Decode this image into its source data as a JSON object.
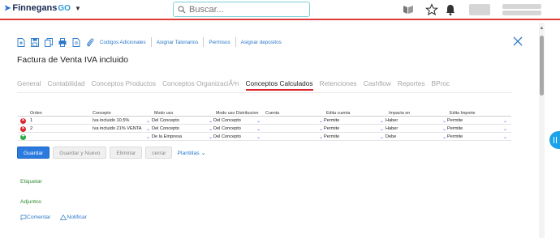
{
  "header": {
    "brand_name": "Finnegans",
    "brand_suffix": "GO",
    "search_placeholder": "Buscar..."
  },
  "toolbar": {
    "links": [
      "Codigos Adicionales",
      "Asignar Talonarios",
      "Permisos",
      "Asignar depositos"
    ]
  },
  "page": {
    "title": "Factura de Venta IVA incluido"
  },
  "tabs": [
    {
      "label": "General",
      "active": false
    },
    {
      "label": "Contabilidad",
      "active": false
    },
    {
      "label": "Conceptos Productos",
      "active": false
    },
    {
      "label": "Conceptos OrganizaciÃ³n",
      "active": false
    },
    {
      "label": "Conceptos Calculados",
      "active": true
    },
    {
      "label": "Retenciones",
      "active": false
    },
    {
      "label": "Cashflow",
      "active": false
    },
    {
      "label": "Reportes",
      "active": false
    },
    {
      "label": "BProc",
      "active": false
    }
  ],
  "grid": {
    "columns": [
      "Orden",
      "Concepto",
      "Modo uso",
      "Modo uso Distribucion",
      "Cuenta",
      "Edita cuenta",
      "Impacta en",
      "Edita Importe"
    ],
    "rows": [
      {
        "orden": "1",
        "concepto": "Iva incluido 10.5%",
        "modo_uso": "Del Concepto",
        "modo_uso_dist": "Del Concepto",
        "cuenta": "",
        "edita_cuenta": "Permite",
        "impacta_en": "Haber",
        "edita_importe": "Permite"
      },
      {
        "orden": "2",
        "concepto": "Iva incluido 21% VENTA",
        "modo_uso": "Del Concepto",
        "modo_uso_dist": "Del Concepto",
        "cuenta": "",
        "edita_cuenta": "Permite",
        "impacta_en": "Haber",
        "edita_importe": "Permite"
      }
    ],
    "new_row": {
      "orden": "",
      "concepto": "",
      "modo_uso": "De la Empresa",
      "modo_uso_dist": "Del Concepto",
      "cuenta": "",
      "edita_cuenta": "Permite",
      "impacta_en": "Debe",
      "edita_importe": "Permite"
    }
  },
  "buttons": {
    "save": "Guardar",
    "save_new": "Guardar y Nuevo",
    "delete": "Eliminar",
    "close": "cerrar",
    "templates": "Plantillas"
  },
  "sections": {
    "tag": "Etiquetar",
    "attachments": "Adjuntos"
  },
  "actions": {
    "comment": "Comentar",
    "notify": "Notificar"
  },
  "colors": {
    "accent": "#2a7ae0",
    "danger": "#d8262b",
    "success": "#2aa843",
    "brand_bar": "#e03c3c"
  }
}
